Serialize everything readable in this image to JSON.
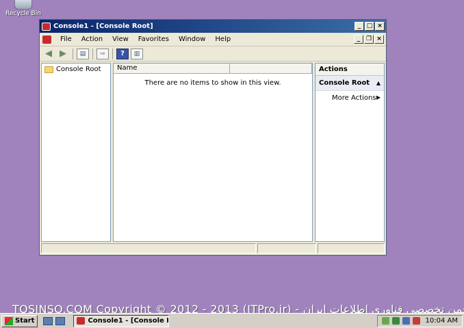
{
  "desktop": {
    "recycle_bin_label": "Recycle Bin"
  },
  "window": {
    "title": "Console1 - [Console Root]",
    "menu": [
      "File",
      "Action",
      "View",
      "Favorites",
      "Window",
      "Help"
    ],
    "tree": {
      "root_label": "Console Root"
    },
    "list": {
      "column_name": "Name",
      "empty_message": "There are no items to show in this view."
    },
    "actions": {
      "header": "Actions",
      "section": "Console Root",
      "more_actions": "More Actions"
    }
  },
  "watermark": "TOSINSO.COM Copyright © 2012 - 2013 (ITPro.ir) - انجمن تخصصی فناوری اطلاعات ایران",
  "taskbar": {
    "start_label": "Start",
    "task_title": "Console1 - [Console R...",
    "clock": "10:04 AM"
  }
}
